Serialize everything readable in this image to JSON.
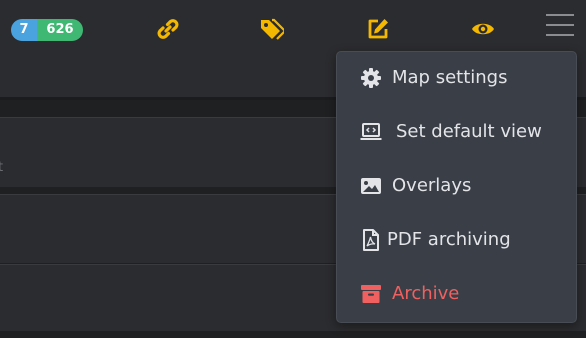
{
  "colors": {
    "background": "#1f2022",
    "topbar": "#2b2c2f",
    "icon_accent": "#f5b800",
    "badge_blue": "#4aa3df",
    "badge_green": "#3fb873",
    "dropdown_bg": "#3a3f47",
    "danger": "#f06060"
  },
  "header": {
    "badges": {
      "count": "7",
      "total": "626"
    },
    "icons": [
      "link-icon",
      "tags-icon",
      "edit-icon",
      "eye-icon",
      "hamburger-menu-icon"
    ]
  },
  "list": {
    "row1_text": "t"
  },
  "dropdown": {
    "items": [
      {
        "label": "Map settings",
        "icon": "gear-icon"
      },
      {
        "label": "Set default view",
        "icon": "laptop-code-icon"
      },
      {
        "label": "Overlays",
        "icon": "image-icon"
      },
      {
        "label": "PDF archiving",
        "icon": "pdf-file-icon"
      },
      {
        "label": "Archive",
        "icon": "archive-box-icon"
      }
    ]
  }
}
